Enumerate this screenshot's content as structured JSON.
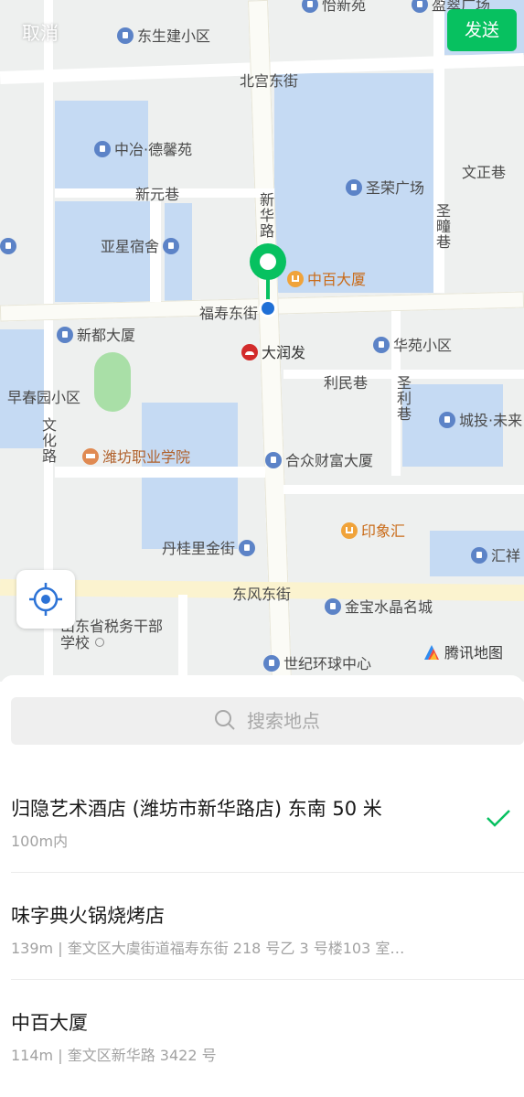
{
  "header": {
    "cancel_label": "取消",
    "send_label": "发送"
  },
  "map": {
    "labels": {
      "yixinyuan": "怡新苑",
      "yingcuiguangchang": "盈翠广场",
      "dongshengjian": "东生建小区",
      "beigongdongjie": "北宫东街",
      "zhongye": "中冶·德馨苑",
      "wenzhengxiang": "文正巷",
      "xinyuanxiang": "新元巷",
      "xinhualu": "新华路",
      "shengrongguangchang": "圣荣广场",
      "shengtongxiang": "圣疃巷",
      "yaxingsushe": "亚星宿舍",
      "zhongbaidasha": "中百大厦",
      "fushoudongjie": "福寿东街",
      "xindudasha": "新都大厦",
      "darunfa": "大润发",
      "huayuanxiaoqu": "华苑小区",
      "zaochunyuan": "早春园小区",
      "liminxiang": "利民巷",
      "shenglixiang": "圣利巷",
      "chengtou": "城投·未来",
      "wenhualu": "文化路",
      "weifangzhiye": "潍坊职业学院",
      "hezhongcaifu": "合众财富大厦",
      "yinxianghui": "印象汇",
      "danguilijinjie": "丹桂里金街",
      "huixiang": "汇祥",
      "dongfengdongjie": "东风东街",
      "jinbaoshuijing": "金宝水晶名城",
      "shuiwu": "山东省税务干部学校",
      "shijihuanqiu": "世纪环球中心"
    },
    "brand": "腾讯地图",
    "colors": {
      "blocks": "#c5daf3",
      "green": "#a9dfa7",
      "pin": "#07c160",
      "dot": "#1f6fd6"
    }
  },
  "search": {
    "placeholder": "搜索地点"
  },
  "results": [
    {
      "name": "归隐艺术酒店 (潍坊市新华路店) 东南 50 米",
      "address": "100m内",
      "selected": true
    },
    {
      "name": "味字典火锅烧烤店",
      "address": "139m | 奎文区大虞街道福寿东街 218 号乙 3 号楼103 室…",
      "selected": false
    },
    {
      "name": "中百大厦",
      "address": "114m | 奎文区新华路 3422 号",
      "selected": false
    }
  ]
}
